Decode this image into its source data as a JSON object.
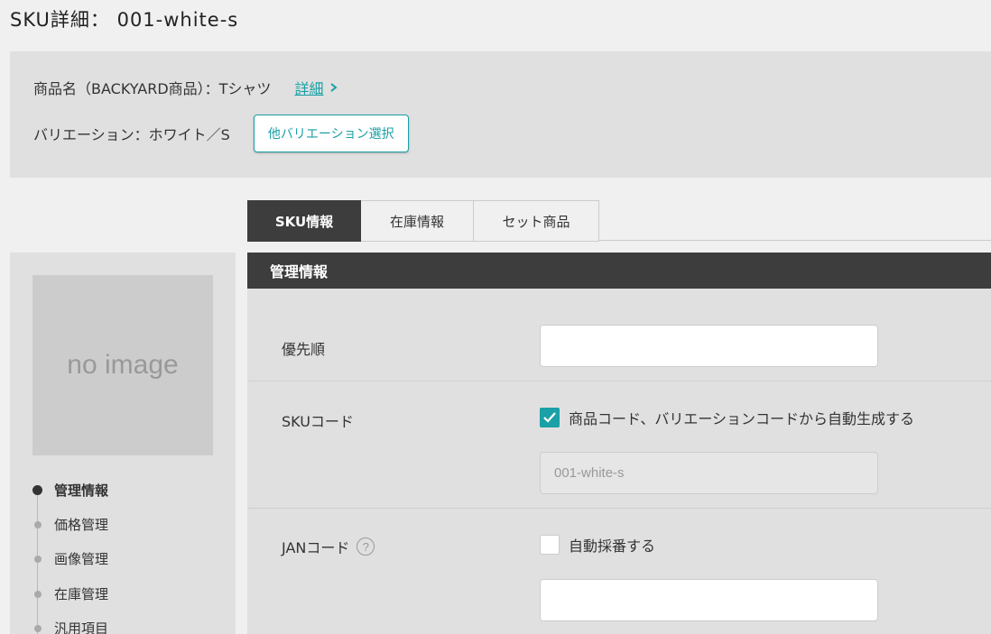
{
  "page": {
    "title": "SKU詳細： 001-white-s"
  },
  "product": {
    "name_label": "商品名（BACKYARD商品）：Tシャツ",
    "detail_link": "詳細",
    "variation_label": "バリエーション：ホワイト／S",
    "other_variation_button": "他バリエーション選択"
  },
  "tabs": [
    {
      "label": "SKU情報",
      "active": true
    },
    {
      "label": "在庫情報",
      "active": false
    },
    {
      "label": "セット商品",
      "active": false
    }
  ],
  "sidebar": {
    "image_placeholder": "no image",
    "items": [
      {
        "label": "管理情報",
        "active": true
      },
      {
        "label": "価格管理",
        "active": false
      },
      {
        "label": "画像管理",
        "active": false
      },
      {
        "label": "在庫管理",
        "active": false
      },
      {
        "label": "汎用項目",
        "active": false
      }
    ]
  },
  "section": {
    "title": "管理情報",
    "priority": {
      "label": "優先順",
      "value": ""
    },
    "sku_code": {
      "label": "SKUコード",
      "auto_generate_label": "商品コード、バリエーションコードから自動生成する",
      "auto_generate_checked": true,
      "value": "001-white-s"
    },
    "jan_code": {
      "label": "JANコード",
      "help_icon": "?",
      "auto_number_label": "自動採番する",
      "auto_number_checked": false,
      "value": ""
    }
  },
  "colors": {
    "accent": "#1aa0a6",
    "dark": "#3d3d3d"
  }
}
